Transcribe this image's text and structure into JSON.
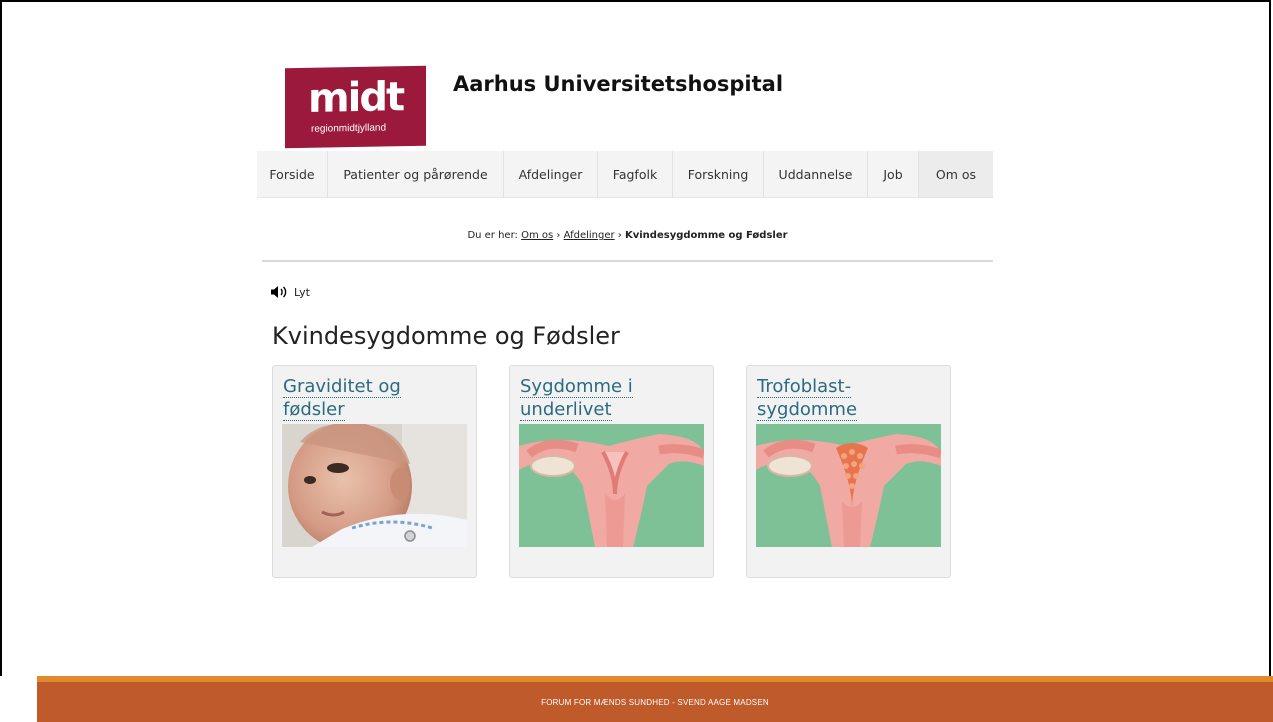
{
  "logo": {
    "main": "midt",
    "sub": "regionmidtjylland"
  },
  "site_title": "Aarhus Universitetshospital",
  "nav": [
    {
      "label": "Forside"
    },
    {
      "label": "Patienter og pårørende"
    },
    {
      "label": "Afdelinger"
    },
    {
      "label": "Fagfolk"
    },
    {
      "label": "Forskning"
    },
    {
      "label": "Uddannelse"
    },
    {
      "label": "Job"
    },
    {
      "label": "Om os",
      "active": true
    }
  ],
  "breadcrumb": {
    "prefix": "Du er her:",
    "links": [
      "Om os",
      "Afdelinger"
    ],
    "separator": "›",
    "current": "Kvindesygdomme og Fødsler"
  },
  "listen": {
    "label": "Lyt",
    "icon": "speaker-icon"
  },
  "page_title": "Kvindesygdomme og Fødsler",
  "cards": [
    {
      "title_lines": [
        "Graviditet og",
        "fødsler"
      ],
      "image": "newborn-baby-photo"
    },
    {
      "title_lines": [
        "Sygdomme i",
        "underlivet"
      ],
      "image": "uterus-illustration"
    },
    {
      "title_lines": [
        "Trofoblast-",
        "sygdomme"
      ],
      "image": "uterus-mole-illustration"
    }
  ],
  "footer": {
    "text": "FORUM FOR MÆNDS SUNDHED - SVEND AAGE MADSEN"
  },
  "colors": {
    "brand": "#9b1a3b",
    "link": "#2b6b82",
    "footer": "#bf5a2b",
    "footer_accent": "#e08a2b",
    "illustration_bg": "#7fc197"
  }
}
